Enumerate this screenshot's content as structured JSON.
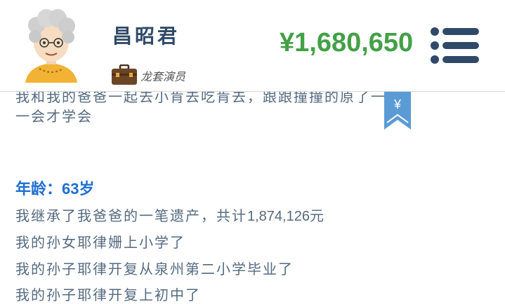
{
  "header": {
    "name": "昌昭君",
    "job_label": "龙套演员",
    "money": "¥1,680,650",
    "icons": {
      "avatar": "elderly-woman-avatar",
      "job": "briefcase-icon",
      "menu": "menu-list-icon",
      "bookmark": "yen-bookmark-icon"
    }
  },
  "content": {
    "prev_line_partial": "我和我的爸爸一起去小肯去吃肯去，跟跟撞撞的原了一只",
    "prev_line": "一会才学会",
    "age_label": "年龄：",
    "age_value": "63岁",
    "events": [
      {
        "text": "我继承了我爸爸的一笔遗产，共计",
        "num": "1,874,126",
        "suffix": "元"
      },
      {
        "text": "我的孙女耶律姗上小学了"
      },
      {
        "text": "我的孙子耶律开复从泉州第二小学毕业了"
      },
      {
        "text": "我的孙子耶律开复上初中了"
      }
    ]
  },
  "colors": {
    "money": "#43a047",
    "age": "#1f6fcf",
    "text": "#546a80",
    "bookmark": "#5b9bd5"
  }
}
